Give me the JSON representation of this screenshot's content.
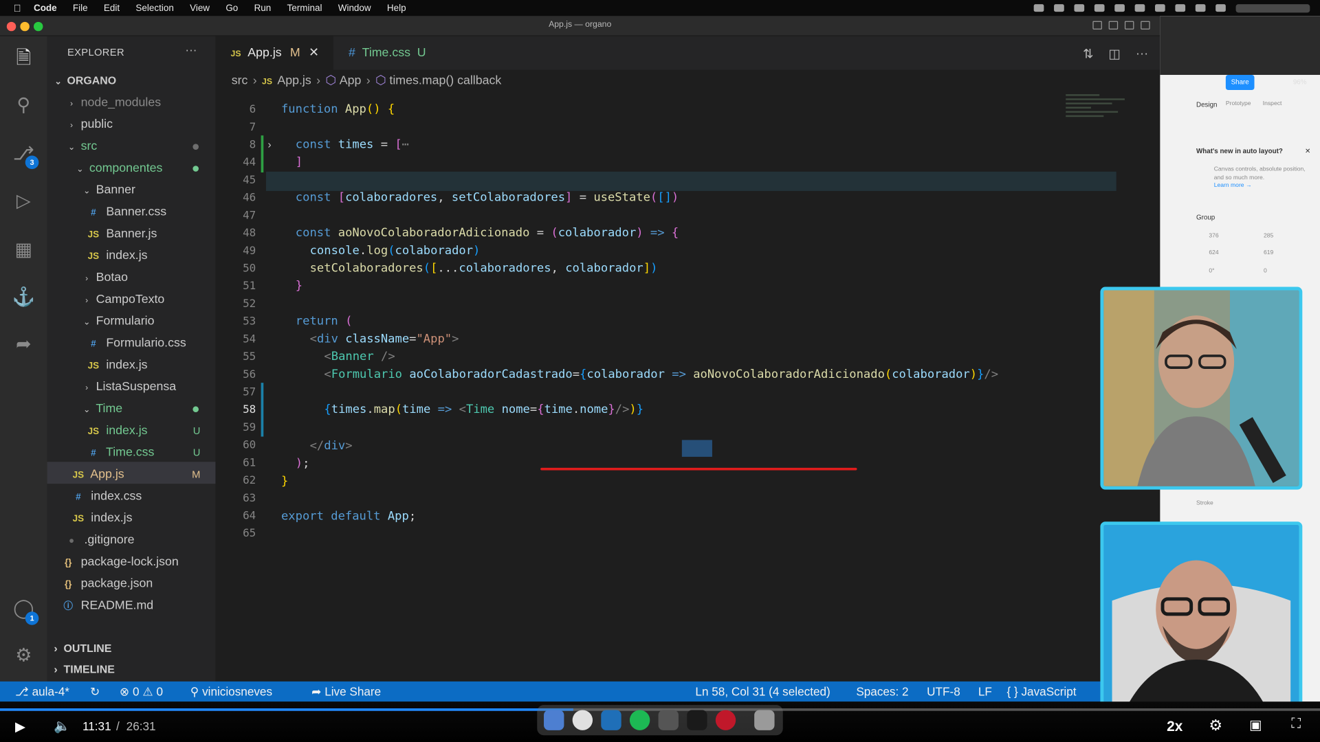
{
  "menubar": {
    "app": "Code",
    "items": [
      "File",
      "Edit",
      "Selection",
      "View",
      "Go",
      "Run",
      "Terminal",
      "Window",
      "Help"
    ]
  },
  "window": {
    "title": "App.js — organo"
  },
  "activity": {
    "scm_badge": "3",
    "account_badge": "1"
  },
  "explorer": {
    "header": "EXPLORER",
    "root": "ORGANO",
    "items": [
      {
        "label": "node_modules"
      },
      {
        "label": "public"
      },
      {
        "label": "src"
      },
      {
        "label": "componentes"
      },
      {
        "label": "Banner"
      },
      {
        "label": "Banner.css"
      },
      {
        "label": "Banner.js"
      },
      {
        "label": "index.js"
      },
      {
        "label": "Botao"
      },
      {
        "label": "CampoTexto"
      },
      {
        "label": "Formulario"
      },
      {
        "label": "Formulario.css"
      },
      {
        "label": "index.js"
      },
      {
        "label": "ListaSuspensa"
      },
      {
        "label": "Time"
      },
      {
        "label": "index.js",
        "status": "U"
      },
      {
        "label": "Time.css",
        "status": "U"
      },
      {
        "label": "App.js",
        "status": "M"
      },
      {
        "label": "index.css"
      },
      {
        "label": "index.js"
      },
      {
        "label": ".gitignore"
      },
      {
        "label": "package-lock.json"
      },
      {
        "label": "package.json"
      },
      {
        "label": "README.md"
      }
    ],
    "outline": "OUTLINE",
    "timeline": "TIMELINE"
  },
  "tabs": [
    {
      "icon": "JS",
      "label": "App.js",
      "status": "M"
    },
    {
      "icon": "#",
      "label": "Time.css",
      "status": "U"
    }
  ],
  "breadcrumb": [
    "src",
    "App.js",
    "App",
    "times.map() callback"
  ],
  "code": {
    "line_numbers": [
      "6",
      "7",
      "8",
      "44",
      "45",
      "46",
      "47",
      "48",
      "49",
      "50",
      "51",
      "52",
      "53",
      "54",
      "55",
      "56",
      "57",
      "58",
      "59",
      "60",
      "61",
      "62",
      "63",
      "64",
      "65"
    ],
    "cursor_word": "Time"
  },
  "status": {
    "branch": "aula-4*",
    "errors": "0",
    "warnings": "0",
    "user": "viniciosneves",
    "live_share": "Live Share",
    "position": "Ln 58, Col 31 (4 selected)",
    "spaces": "Spaces: 2",
    "encoding": "UTF-8",
    "eol": "LF",
    "language": "JavaScript"
  },
  "figma": {
    "share": "Share",
    "zoom": "96%",
    "tabs": [
      "Design",
      "Prototype",
      "Inspect"
    ],
    "tooltip_title": "What's new in auto layout?",
    "tooltip_body": "Canvas controls, absolute position, and so much more.",
    "tooltip_link": "Learn more →",
    "group": "Group",
    "x": "376",
    "y": "285",
    "w": "624",
    "h": "619",
    "rot": "0°",
    "radius": "0",
    "stroke": "Stroke"
  },
  "video": {
    "current": "11:31",
    "sep": "/",
    "duration": "26:31",
    "progress": 0.4346,
    "speed": "2x"
  },
  "colors": {
    "status_bar": "#0c6cc4",
    "accent_git_added": "#73c991",
    "progress": "#1e88ff",
    "webcam_border": "#3cc8ee"
  }
}
